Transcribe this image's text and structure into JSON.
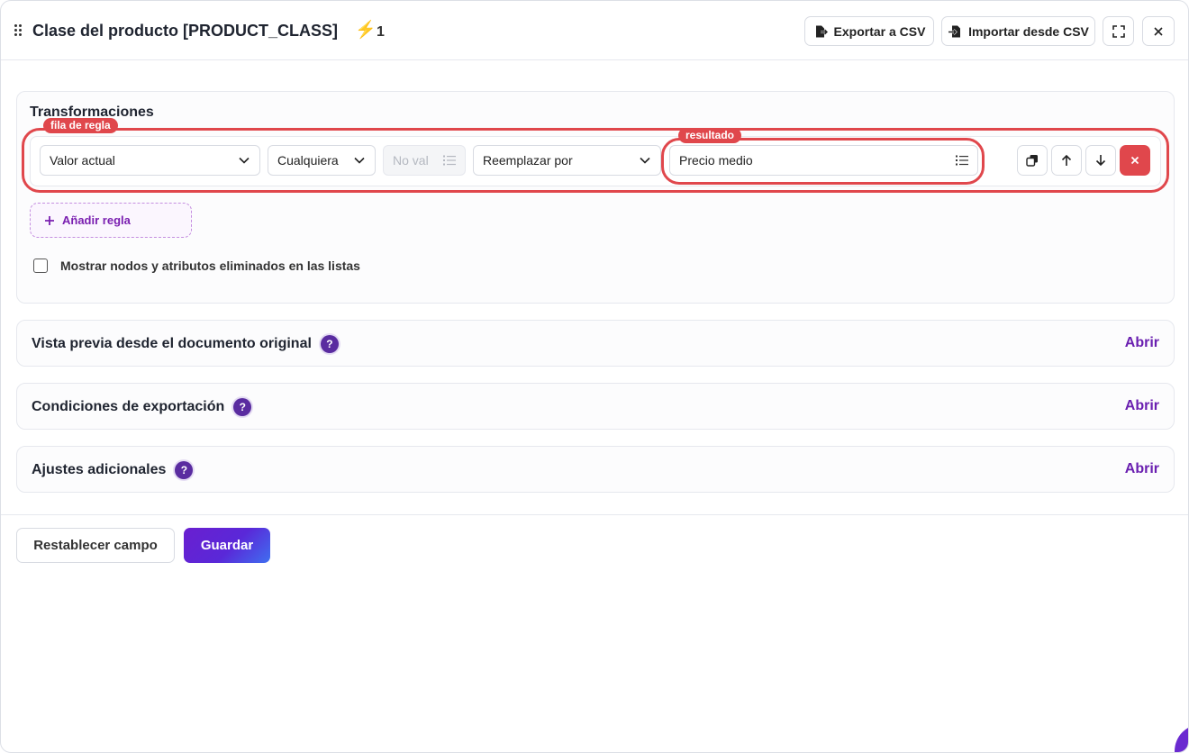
{
  "header": {
    "title": "Clase del producto [PRODUCT_CLASS]",
    "bolt_count": "1",
    "export_label": "Exportar a CSV",
    "import_label": "Importar desde CSV"
  },
  "transformations": {
    "title": "Transformaciones",
    "row_tag": "fila de regla",
    "result_tag": "resultado",
    "rule": {
      "source": "Valor actual",
      "condition": "Cualquiera",
      "value_placeholder": "No val",
      "action": "Reemplazar por",
      "result": "Precio medio"
    },
    "add_rule_label": "Añadir regla",
    "show_deleted_label": "Mostrar nodos y atributos eliminados en las listas"
  },
  "sections": [
    {
      "title": "Vista previa desde el documento original",
      "action": "Abrir"
    },
    {
      "title": "Condiciones de exportación",
      "action": "Abrir"
    },
    {
      "title": "Ajustes adicionales",
      "action": "Abrir"
    }
  ],
  "footer": {
    "reset_label": "Restablecer campo",
    "save_label": "Guardar"
  },
  "colors": {
    "accent": "#6a1fb0",
    "danger": "#e0474c",
    "bolt": "#f2b400"
  }
}
